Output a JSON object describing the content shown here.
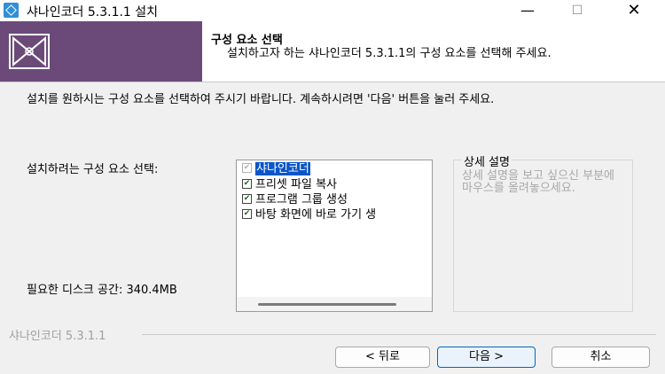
{
  "window": {
    "title": "샤나인코더 5.3.1.1 설치",
    "minimize_glyph": "—",
    "maximize_glyph": "☐",
    "close_glyph": "✕"
  },
  "header": {
    "title": "구성 요소 선택",
    "description": "설치하고자 하는 샤나인코더 5.3.1.1의 구성 요소를 선택해 주세요."
  },
  "body": {
    "instruction": "설치를 원하시는 구성 요소를 선택하여 주시기 바랍니다. 계속하시려면 '다음' 버튼을 눌러 주세요.",
    "select_label": "설치하려는 구성 요소 선택:",
    "space_label": "필요한 디스크 공간: 340.4MB"
  },
  "components": [
    {
      "label": "샤나인코더",
      "checked": true,
      "disabled": true,
      "selected": true
    },
    {
      "label": "프리셋 파일 복사",
      "checked": true,
      "disabled": false,
      "selected": false
    },
    {
      "label": "프로그램 그룹 생성",
      "checked": true,
      "disabled": false,
      "selected": false
    },
    {
      "label": "바탕 화면에 바로 가기 생",
      "checked": true,
      "disabled": false,
      "selected": false
    }
  ],
  "description_panel": {
    "title": "상세 설명",
    "placeholder": "상세 설명을 보고 싶으신 부분에 마우스를 올려놓으세요."
  },
  "footer": {
    "brand": "샤나인코더 5.3.1.1",
    "back_button": "< 뒤로",
    "next_button": "다음 >",
    "cancel_button": "취소"
  },
  "colors": {
    "banner_side": "#6b4a79",
    "selection": "#0a55c8",
    "check": "#1a6f1a",
    "default_button_border": "#0067c0"
  },
  "icons": [
    "installer-app-icon",
    "installer-logo-icon",
    "checkmark-icon"
  ]
}
